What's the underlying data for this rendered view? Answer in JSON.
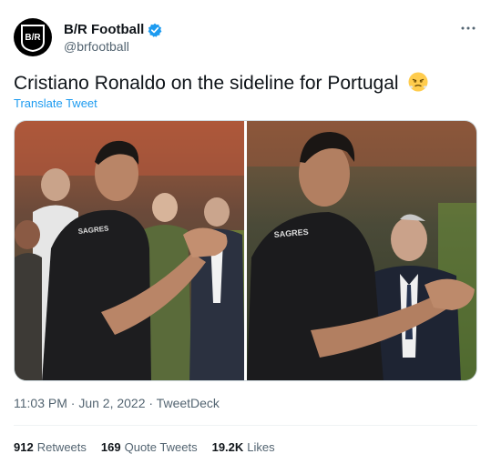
{
  "account": {
    "display_name": "B/R Football",
    "handle": "@brfootball",
    "avatar_text": "B/R",
    "verified": true
  },
  "tweet": {
    "text": "Cristiano Ronaldo on the sideline for Portugal",
    "emoji": "face-with-steam-from-nose",
    "translate_label": "Translate Tweet",
    "timestamp": "11:03 PM · Jun 2, 2022 · TweetDeck",
    "more_icon": "more-icon"
  },
  "media": {
    "photos": [
      {
        "shirt_text": "SAGRES"
      },
      {
        "shirt_text": "SAGRES"
      }
    ]
  },
  "stats": {
    "retweets_count": "912",
    "retweets_label": "Retweets",
    "quotes_count": "169",
    "quotes_label": "Quote Tweets",
    "likes_count": "19.2K",
    "likes_label": "Likes"
  },
  "colors": {
    "accent": "#1d9bf0",
    "text": "#0f1419",
    "muted": "#536471"
  }
}
